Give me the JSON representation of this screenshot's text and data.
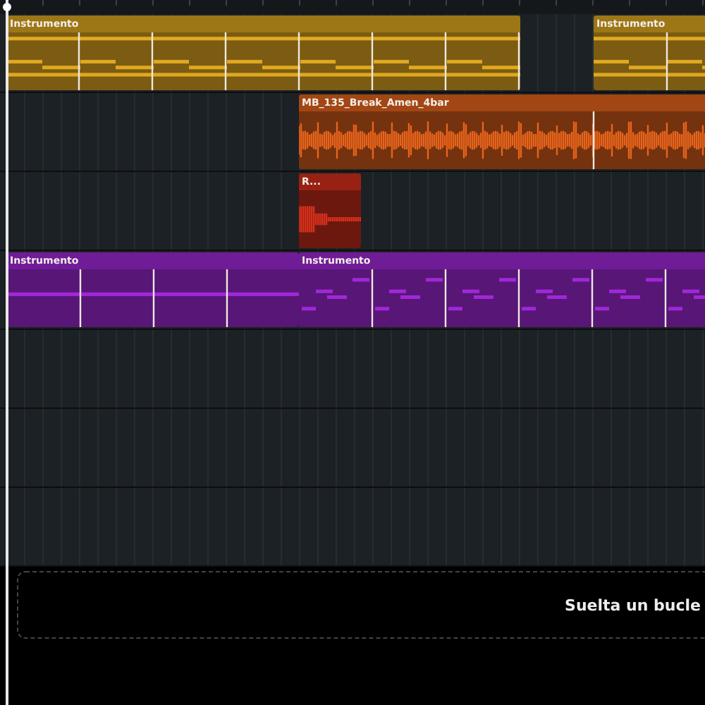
{
  "tracks": [
    {
      "kind": "clips",
      "clips": [
        {
          "kind": "midi",
          "name": "Instrumento",
          "color": "#e0a820"
        },
        {
          "kind": "midi",
          "name": "Instrumento",
          "color": "#e0a820"
        }
      ]
    },
    {
      "kind": "clips",
      "clips": [
        {
          "kind": "audio",
          "name": "MB_135_Break_Amen_4bar",
          "color": "#e8641c"
        }
      ]
    },
    {
      "kind": "clips",
      "clips": [
        {
          "kind": "audio",
          "name": "R...",
          "color": "#d8301c"
        }
      ]
    },
    {
      "kind": "clips",
      "clips": [
        {
          "kind": "midi",
          "name": "Instrumento",
          "color": "#a028d8"
        },
        {
          "kind": "midi",
          "name": "Instrumento",
          "color": "#a028d8"
        }
      ]
    },
    {
      "kind": "empty"
    },
    {
      "kind": "empty"
    },
    {
      "kind": "empty"
    }
  ],
  "drop_zone": {
    "text": "Suelta un bucle"
  }
}
